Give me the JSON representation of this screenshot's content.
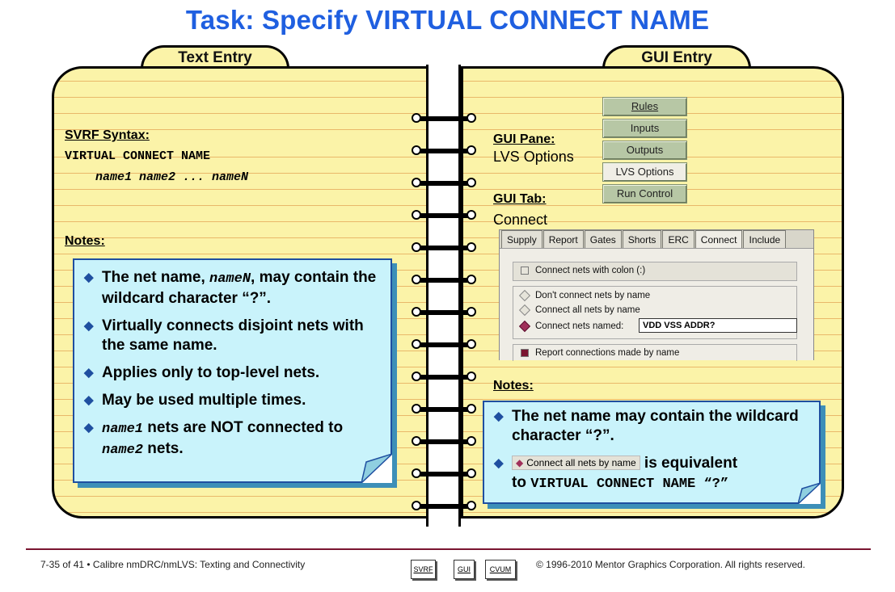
{
  "title": "Task: Specify VIRTUAL CONNECT NAME",
  "tabs": {
    "left": "Text Entry",
    "right": "GUI Entry"
  },
  "left": {
    "syntax_label": "SVRF Syntax:",
    "syntax_line1": "VIRTUAL CONNECT NAME",
    "syntax_line2": "name1 name2 ... nameN",
    "notes_label": "Notes:",
    "notes": {
      "n1_a": "The net name, ",
      "n1_code": "nameN",
      "n1_b": ", may contain the wildcard character “?”.",
      "n2": "Virtually connects disjoint nets with the same name.",
      "n3": "Applies only to top-level nets.",
      "n4": "May be used multiple times.",
      "n5_code1": "name1",
      "n5_mid": " nets are NOT connected to ",
      "n5_code2": "name2",
      "n5_end": " nets."
    }
  },
  "right": {
    "pane_label": "GUI Pane:",
    "pane_value": "LVS Options",
    "tab_label": "GUI Tab:",
    "tab_value": "Connect",
    "menu": [
      "Rules",
      "Inputs",
      "Outputs",
      "LVS Options",
      "Run Control"
    ],
    "dialog": {
      "tabs": [
        "Supply",
        "Report",
        "Gates",
        "Shorts",
        "ERC",
        "Connect",
        "Include"
      ],
      "colon": "Connect nets with colon (:)",
      "opt1": "Don't connect nets by name",
      "opt2": "Connect all nets by name",
      "opt3": "Connect nets named:",
      "names_value": "VDD VSS ADDR?",
      "report": "Report connections made by name"
    },
    "notes_label": "Notes:",
    "notes": {
      "n1": "The net name may contain the wildcard character “?”.",
      "inline_button": "Connect all nets by name",
      "n2_mid": " is equivalent",
      "n2_to": "to ",
      "n2_code": "VIRTUAL CONNECT NAME “?”"
    }
  },
  "footer": {
    "left": "7-35 of 41 • Calibre nmDRC/nmLVS: Texting and Connectivity",
    "buttons": [
      "SVRF",
      "GUI",
      "CVUM"
    ],
    "right": "© 1996-2010 Mentor Graphics Corporation. All rights reserved."
  },
  "colors": {
    "title": "#1f5fe0",
    "paper": "#fbf3a8",
    "note": "#c9f3fb",
    "note_border": "#1f4fa0"
  }
}
